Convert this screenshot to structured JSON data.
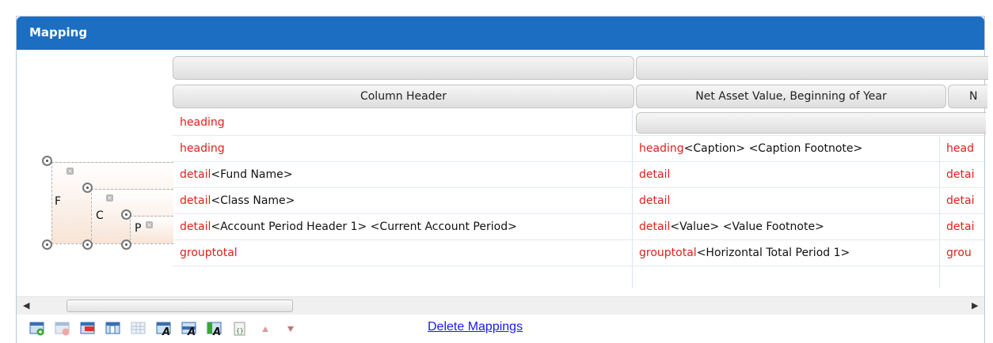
{
  "panel": {
    "title": "Mapping"
  },
  "header": {
    "column_header": "Column Header",
    "col2": "Net Asset Value, Beginning of Year",
    "col3_partial": "N"
  },
  "rows": [
    {
      "c1_kw": "heading",
      "c1_tags": "",
      "c2_kw": "",
      "c2_tags": "",
      "c3_kw": ""
    },
    {
      "c1_kw": "heading",
      "c1_tags": "",
      "c2_kw": "heading",
      "c2_tags": "<Caption> <Caption Footnote>",
      "c3_kw": "head"
    },
    {
      "c1_kw": "detail",
      "c1_tags": "<Fund Name>",
      "c2_kw": "detail",
      "c2_tags": "",
      "c3_kw": "detai"
    },
    {
      "c1_kw": "detail",
      "c1_tags": "<Class Name>",
      "c2_kw": "detail",
      "c2_tags": "",
      "c3_kw": "detai"
    },
    {
      "c1_kw": "detail",
      "c1_tags": "<Account Period Header 1> <Current Account Period>",
      "c2_kw": "detail",
      "c2_tags": "<Value> <Value Footnote>",
      "c3_kw": "detai"
    },
    {
      "c1_kw": "grouptotal",
      "c1_tags": "",
      "c2_kw": "grouptotal",
      "c2_tags": "<Horizontal Total Period 1>",
      "c3_kw": "grou"
    }
  ],
  "nested_labels": {
    "f": "F",
    "c": "C",
    "p": "P"
  },
  "toolbar": {
    "delete_link": "Delete Mappings",
    "icons": [
      "add-row-icon",
      "remove-row-icon",
      "delete-column-icon",
      "insert-column-icon",
      "grid-icon",
      "edit-header-icon",
      "edit-column-icon",
      "edit-cell-icon",
      "braces-icon",
      "move-up-icon",
      "move-down-icon"
    ]
  },
  "colors": {
    "title_bar": "#1b6ec2",
    "keyword": "#e0201b",
    "link": "#1a1aee"
  }
}
